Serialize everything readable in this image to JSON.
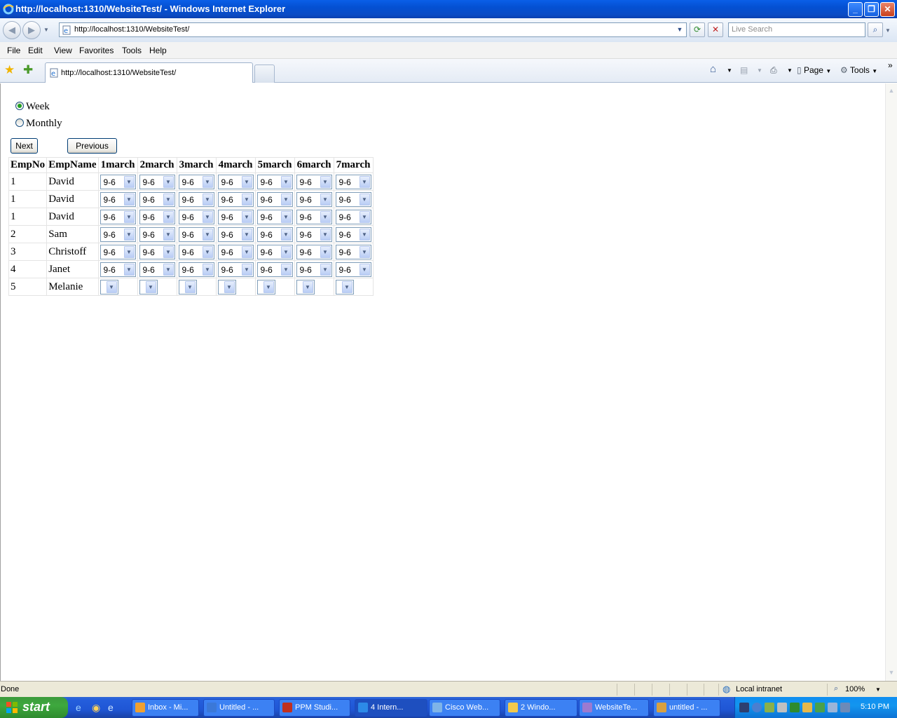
{
  "window": {
    "title": "http://localhost:1310/WebsiteTest/ - Windows Internet Explorer",
    "minimize_icon": "minimize-icon",
    "maximize_icon": "restore-icon",
    "close_icon": "close-icon"
  },
  "address": {
    "url": "http://localhost:1310/WebsiteTest/",
    "search_placeholder": "Live Search"
  },
  "menu": [
    "File",
    "Edit",
    "View",
    "Favorites",
    "Tools",
    "Help"
  ],
  "tab": {
    "label": "http://localhost:1310/WebsiteTest/"
  },
  "commands": {
    "page": "Page",
    "tools": "Tools"
  },
  "form": {
    "options": [
      {
        "label": "Week",
        "checked": true
      },
      {
        "label": "Monthly",
        "checked": false
      }
    ],
    "next_label": "Next",
    "previous_label": "Previous"
  },
  "grid": {
    "headers": [
      "EmpNo",
      "EmpName",
      "1march",
      "2march",
      "3march",
      "4march",
      "5march",
      "6march",
      "7march"
    ],
    "rows": [
      {
        "empno": "1",
        "name": "David",
        "shifts": [
          "9-6",
          "9-6",
          "9-6",
          "9-6",
          "9-6",
          "9-6",
          "9-6"
        ]
      },
      {
        "empno": "1",
        "name": "David",
        "shifts": [
          "9-6",
          "9-6",
          "9-6",
          "9-6",
          "9-6",
          "9-6",
          "9-6"
        ]
      },
      {
        "empno": "1",
        "name": "David",
        "shifts": [
          "9-6",
          "9-6",
          "9-6",
          "9-6",
          "9-6",
          "9-6",
          "9-6"
        ]
      },
      {
        "empno": "2",
        "name": "Sam",
        "shifts": [
          "9-6",
          "9-6",
          "9-6",
          "9-6",
          "9-6",
          "9-6",
          "9-6"
        ]
      },
      {
        "empno": "3",
        "name": "Christoff",
        "shifts": [
          "9-6",
          "9-6",
          "9-6",
          "9-6",
          "9-6",
          "9-6",
          "9-6"
        ]
      },
      {
        "empno": "4",
        "name": "Janet",
        "shifts": [
          "9-6",
          "9-6",
          "9-6",
          "9-6",
          "9-6",
          "9-6",
          "9-6"
        ]
      },
      {
        "empno": "5",
        "name": "Melanie",
        "shifts": [
          "",
          "",
          "",
          "",
          "",
          "",
          ""
        ]
      }
    ]
  },
  "status": {
    "text": "Done",
    "zone": "Local intranet",
    "zoom": "100%"
  },
  "taskbar": {
    "start_label": "start",
    "tasks": [
      {
        "label": "Inbox - Mi...",
        "color": "#f0a030"
      },
      {
        "label": "Untitled - ...",
        "color": "#3b78d8"
      },
      {
        "label": "PPM Studi...",
        "color": "#c03020"
      },
      {
        "label": "4 Intern...",
        "color": "#2c8ae8"
      },
      {
        "label": "Cisco Web...",
        "color": "#7fb4e8"
      },
      {
        "label": "2 Windo...",
        "color": "#f2c94c"
      },
      {
        "label": "WebsiteTe...",
        "color": "#9c7ad0"
      },
      {
        "label": "untitled - ...",
        "color": "#d8a040"
      }
    ],
    "clock": "5:10 PM"
  }
}
